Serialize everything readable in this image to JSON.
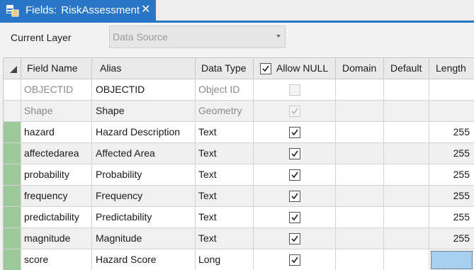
{
  "tab": {
    "prefix": "Fields:",
    "title": "RiskAssessment",
    "close_glyph": "✕",
    "icon": "fields-table-icon",
    "accent": "#2a76c6"
  },
  "toolbar": {
    "current_layer_label": "Current Layer",
    "data_source_value": "Data Source"
  },
  "table": {
    "headers": {
      "field_name": "Field Name",
      "alias": "Alias",
      "data_type": "Data Type",
      "allow_null": "Allow NULL",
      "domain": "Domain",
      "default": "Default",
      "length": "Length"
    },
    "rows": [
      {
        "field": "OBJECTID",
        "alias": "OBJECTID",
        "type": "Object ID",
        "allow_null": false,
        "null_disabled": true,
        "domain": "",
        "default": "",
        "length": "",
        "readonly": true,
        "edited": false
      },
      {
        "field": "Shape",
        "alias": "Shape",
        "type": "Geometry",
        "allow_null": true,
        "null_disabled": true,
        "domain": "",
        "default": "",
        "length": "",
        "readonly": true,
        "edited": false
      },
      {
        "field": "hazard",
        "alias": "Hazard Description",
        "type": "Text",
        "allow_null": true,
        "null_disabled": false,
        "domain": "",
        "default": "",
        "length": "255",
        "readonly": false,
        "edited": true
      },
      {
        "field": "affectedarea",
        "alias": "Affected Area",
        "type": "Text",
        "allow_null": true,
        "null_disabled": false,
        "domain": "",
        "default": "",
        "length": "255",
        "readonly": false,
        "edited": true
      },
      {
        "field": "probability",
        "alias": "Probability",
        "type": "Text",
        "allow_null": true,
        "null_disabled": false,
        "domain": "",
        "default": "",
        "length": "255",
        "readonly": false,
        "edited": true
      },
      {
        "field": "frequency",
        "alias": "Frequency",
        "type": "Text",
        "allow_null": true,
        "null_disabled": false,
        "domain": "",
        "default": "",
        "length": "255",
        "readonly": false,
        "edited": true
      },
      {
        "field": "predictability",
        "alias": "Predictability",
        "type": "Text",
        "allow_null": true,
        "null_disabled": false,
        "domain": "",
        "default": "",
        "length": "255",
        "readonly": false,
        "edited": true
      },
      {
        "field": "magnitude",
        "alias": "Magnitude",
        "type": "Text",
        "allow_null": true,
        "null_disabled": false,
        "domain": "",
        "default": "",
        "length": "255",
        "readonly": false,
        "edited": true
      },
      {
        "field": "score",
        "alias": "Hazard Score",
        "type": "Long",
        "allow_null": true,
        "null_disabled": false,
        "domain": "",
        "default": "",
        "length": "",
        "readonly": false,
        "edited": true,
        "length_selected": true
      }
    ]
  },
  "colors": {
    "edited_marker": "#9ec99a",
    "selected_cell": "#a7cff2"
  }
}
